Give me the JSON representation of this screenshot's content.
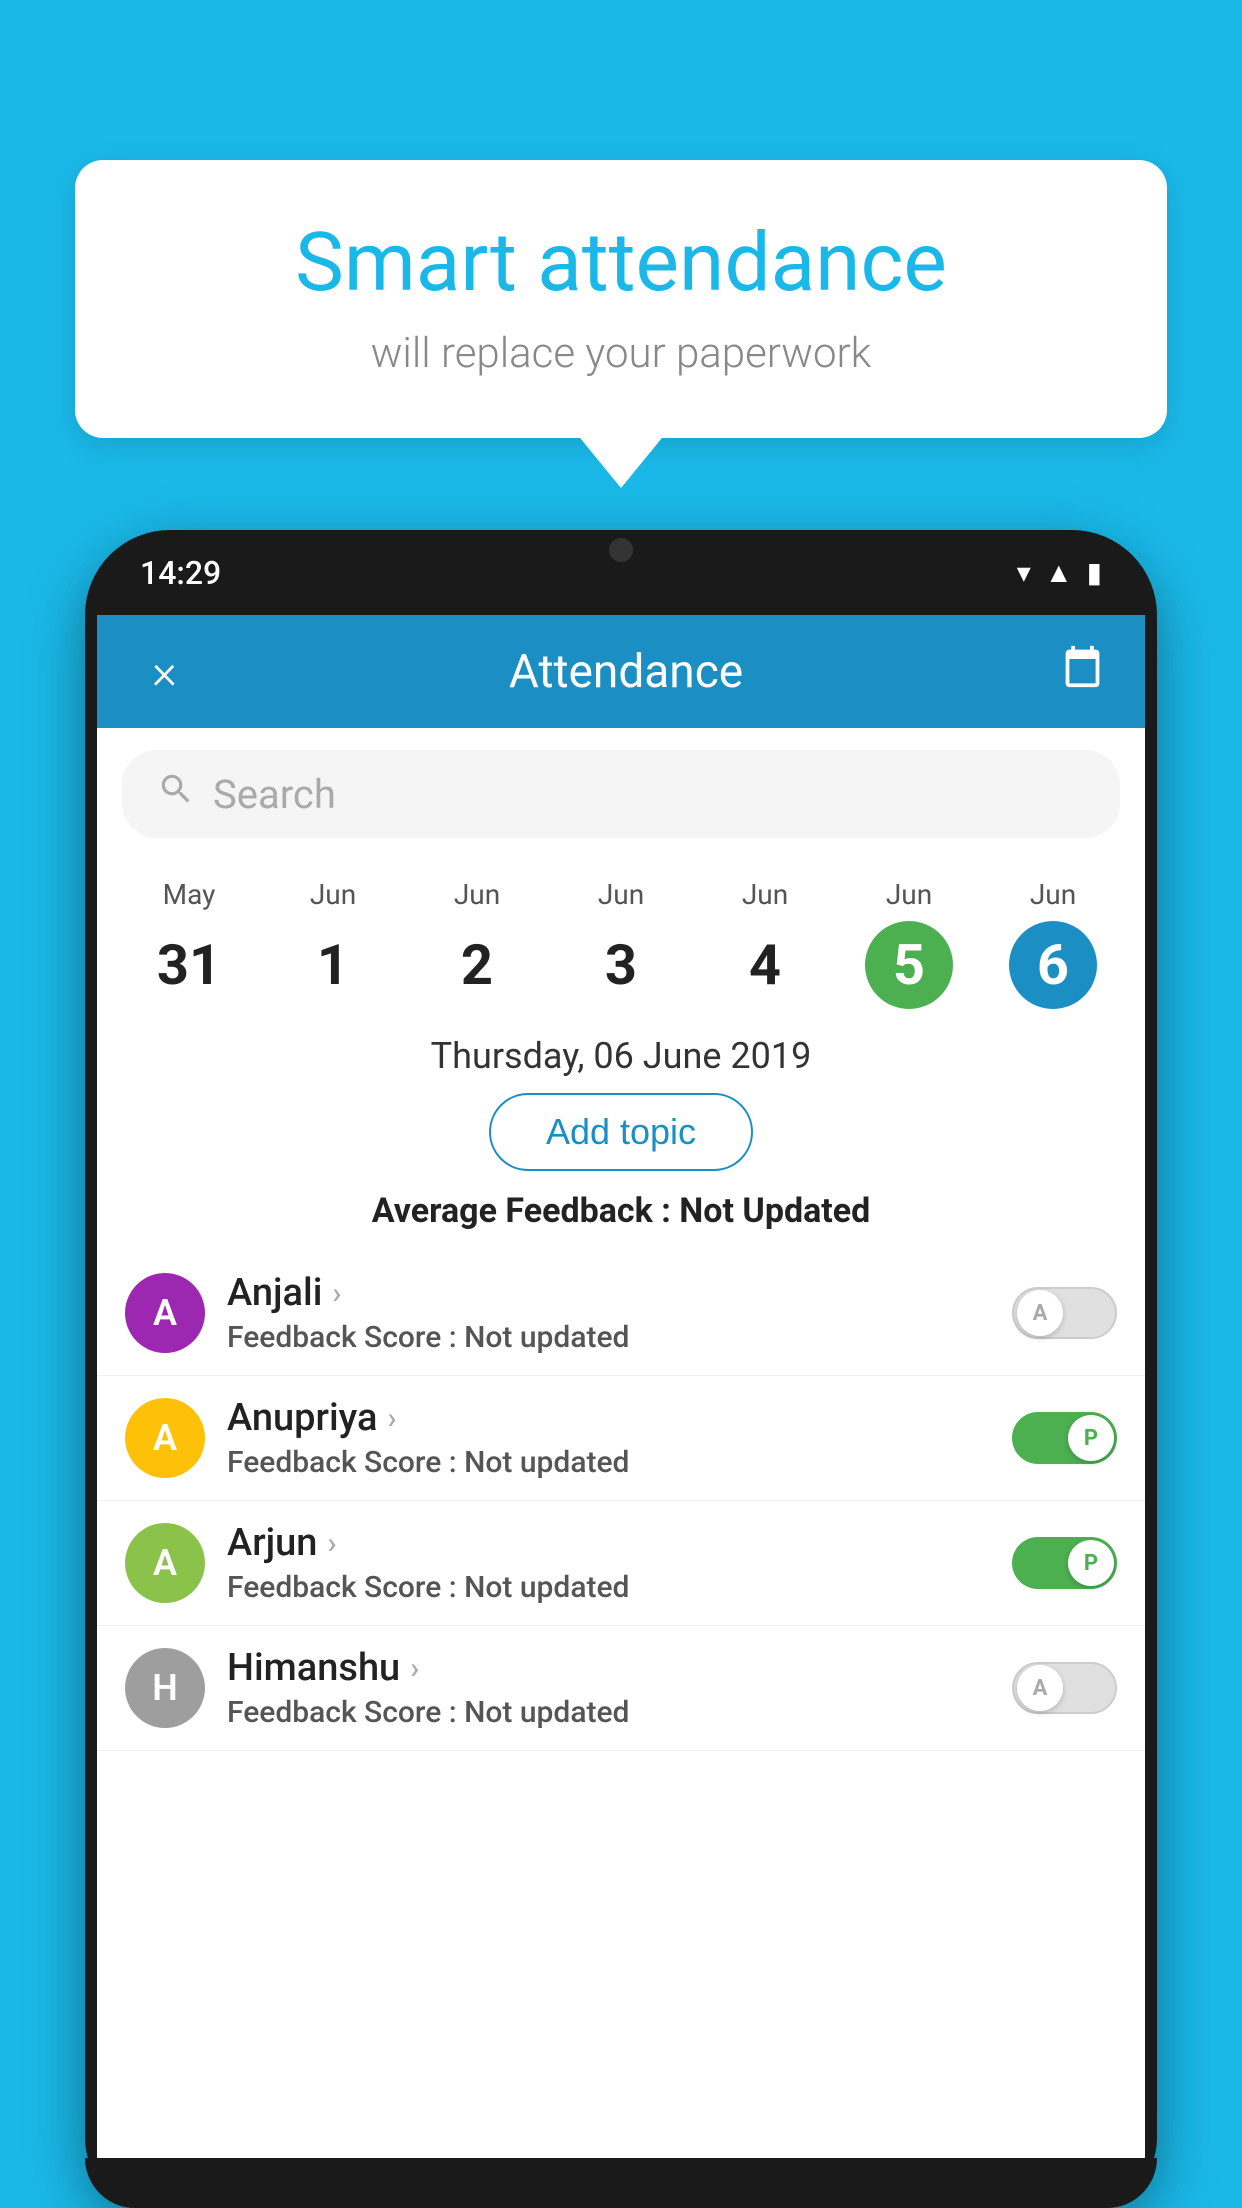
{
  "background_color": "#1AB8E8",
  "bubble": {
    "title": "Smart attendance",
    "subtitle": "will replace your paperwork"
  },
  "phone": {
    "time": "14:29",
    "status_icons": [
      "wifi",
      "signal",
      "battery"
    ]
  },
  "app": {
    "header": {
      "title": "Attendance",
      "close_label": "×",
      "calendar_icon": "📅"
    },
    "search": {
      "placeholder": "Search"
    },
    "dates": [
      {
        "month": "May",
        "day": "31",
        "style": "normal"
      },
      {
        "month": "Jun",
        "day": "1",
        "style": "normal"
      },
      {
        "month": "Jun",
        "day": "2",
        "style": "normal"
      },
      {
        "month": "Jun",
        "day": "3",
        "style": "normal"
      },
      {
        "month": "Jun",
        "day": "4",
        "style": "normal"
      },
      {
        "month": "Jun",
        "day": "5",
        "style": "green"
      },
      {
        "month": "Jun",
        "day": "6",
        "style": "blue"
      }
    ],
    "selected_date": "Thursday, 06 June 2019",
    "add_topic_label": "Add topic",
    "avg_feedback_prefix": "Average Feedback : ",
    "avg_feedback_value": "Not Updated",
    "students": [
      {
        "name": "Anjali",
        "initial": "A",
        "avatar_color": "#9C27B0",
        "feedback_prefix": "Feedback Score : ",
        "feedback_value": "Not updated",
        "toggle_state": "off",
        "toggle_label": "A"
      },
      {
        "name": "Anupriya",
        "initial": "A",
        "avatar_color": "#FFC107",
        "feedback_prefix": "Feedback Score : ",
        "feedback_value": "Not updated",
        "toggle_state": "on",
        "toggle_label": "P"
      },
      {
        "name": "Arjun",
        "initial": "A",
        "avatar_color": "#8BC34A",
        "feedback_prefix": "Feedback Score : ",
        "feedback_value": "Not updated",
        "toggle_state": "on",
        "toggle_label": "P"
      },
      {
        "name": "Himanshu",
        "initial": "H",
        "avatar_color": "#9E9E9E",
        "feedback_prefix": "Feedback Score : ",
        "feedback_value": "Not updated",
        "toggle_state": "off",
        "toggle_label": "A"
      }
    ]
  }
}
